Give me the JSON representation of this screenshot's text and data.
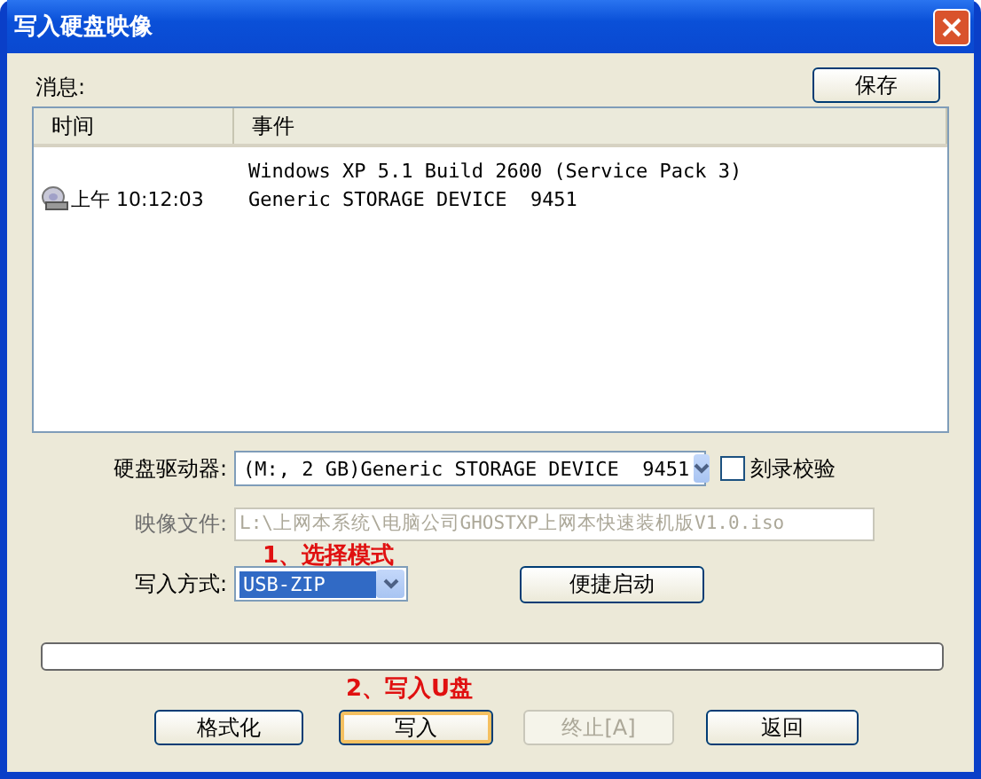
{
  "window": {
    "title": "写入硬盘映像"
  },
  "messages": {
    "label": "消息:",
    "save_button": "保存",
    "columns": [
      "时间",
      "事件"
    ],
    "rows": [
      {
        "time": "",
        "event": "Windows XP 5.1 Build 2600 (Service Pack 3)",
        "icon": false
      },
      {
        "time": "上午 10:12:03",
        "event": "Generic STORAGE DEVICE  9451",
        "icon": true
      }
    ]
  },
  "drive": {
    "label": "硬盘驱动器:",
    "value": "(M:, 2 GB)Generic STORAGE DEVICE  9451"
  },
  "verify": {
    "label": "刻录校验",
    "checked": false
  },
  "image_file": {
    "label": "映像文件:",
    "value": "L:\\上网本系统\\电脑公司GHOSTXP上网本快速装机版V1.0.iso",
    "disabled": true
  },
  "annotation_1": "1、选择模式",
  "write_mode": {
    "label": "写入方式:",
    "value": "USB-ZIP"
  },
  "quick_boot_button": "便捷启动",
  "annotation_2": "2、写入U盘",
  "buttons": [
    {
      "label": "格式化",
      "disabled": false,
      "focused": false
    },
    {
      "label": "写入",
      "disabled": false,
      "focused": true
    },
    {
      "label": "终止[A]",
      "disabled": true,
      "focused": false
    },
    {
      "label": "返回",
      "disabled": false,
      "focused": false
    }
  ]
}
